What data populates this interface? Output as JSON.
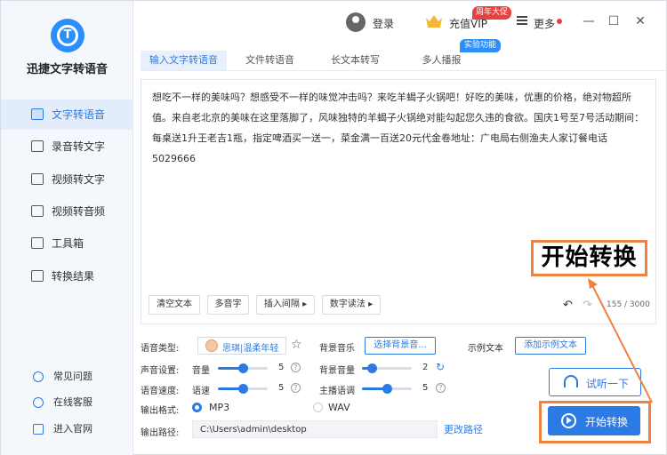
{
  "app": {
    "name": "迅捷文字转语音",
    "logo_letter": "T"
  },
  "sidebar": {
    "items": [
      {
        "label": "文字转语音",
        "icon": "text-to-speech-icon",
        "active": true
      },
      {
        "label": "录音转文字",
        "icon": "recording-icon",
        "active": false
      },
      {
        "label": "视频转文字",
        "icon": "video-text-icon",
        "active": false
      },
      {
        "label": "视频转音频",
        "icon": "video-audio-icon",
        "active": false
      },
      {
        "label": "工具箱",
        "icon": "toolbox-icon",
        "active": false
      },
      {
        "label": "转换结果",
        "icon": "result-icon",
        "active": false
      }
    ],
    "links": [
      {
        "label": "常见问题",
        "icon": "help-icon"
      },
      {
        "label": "在线客服",
        "icon": "headset-icon"
      },
      {
        "label": "进入官网",
        "icon": "monitor-icon"
      }
    ]
  },
  "header": {
    "login": "登录",
    "vip": "充值VIP",
    "vip_badge": "周年大促",
    "more": "更多",
    "minimize": "—",
    "maximize": "☐",
    "close": "✕"
  },
  "tabs": [
    {
      "label": "输入文字转语音",
      "active": true
    },
    {
      "label": "文件转语音",
      "active": false
    },
    {
      "label": "长文本转写",
      "active": false
    },
    {
      "label": "多人播报",
      "active": false
    }
  ],
  "experimental_badge": "实验功能",
  "editor": {
    "text": "想吃不一样的美味吗？想感受不一样的味觉冲击吗？来吃羊蝎子火锅吧！好吃的美味，优惠的价格，绝对物超所值。来自老北京的美味在这里落脚了，风味独特的羊蝎子火锅绝对能勾起您久违的食欲。国庆1号至7号活动期间：每桌送1升王老吉1瓶，指定啤酒买一送一，菜金满一百送20元代金卷地址：广电局右侧渔夫人家订餐电话5029666",
    "buttons": {
      "clear": "清空文本",
      "polyphone": "多音字",
      "insert_pause": "插入间隔 ▸",
      "number_reading": "数字读法 ▸"
    },
    "undo": "↶",
    "redo": "↷",
    "char_count": "155 / 3000"
  },
  "annotation": {
    "callout": "开始转换",
    "color": "#f0823f"
  },
  "settings": {
    "voice_type_label": "语音类型:",
    "voice_name": "思琪|温柔年轻",
    "bg_music_label": "背景音乐",
    "bg_music_button": "选择背景音...",
    "sample_text_label": "示例文本",
    "sample_text_button": "添加示例文本",
    "voice_settings_label": "声音设置:",
    "volume_label": "音量",
    "volume_value": "5",
    "volume_fraction": 0.5,
    "bg_volume_label": "背景音量",
    "bg_volume_value": "2",
    "bg_volume_fraction": 0.2,
    "speed_label": "语音速度:",
    "speed_sub_label": "语速",
    "speed_value": "5",
    "speed_fraction": 0.5,
    "pitch_label": "主播语调",
    "pitch_value": "5",
    "pitch_fraction": 0.5,
    "format_label": "输出格式:",
    "format_mp3": "MP3",
    "format_wav": "WAV",
    "selected_format": "MP3",
    "path_label": "输出路径:",
    "path_value": "C:\\Users\\admin\\desktop",
    "change_path": "更改路径",
    "listen_button": "试听一下",
    "convert_button": "开始转换"
  },
  "colors": {
    "accent": "#2c7be5",
    "sidebar_bg": "#f4f7fb",
    "badge_red": "#e74040"
  }
}
